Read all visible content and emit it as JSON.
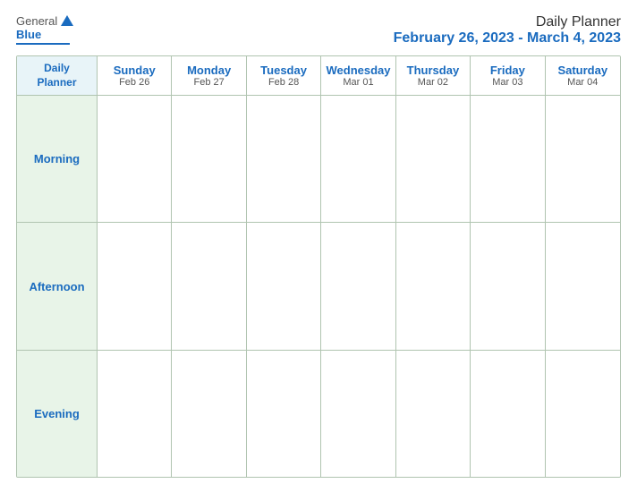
{
  "logo": {
    "general": "General",
    "blue": "Blue"
  },
  "title": {
    "main": "Daily Planner",
    "date_range": "February 26, 2023 - March 4, 2023"
  },
  "calendar": {
    "header": {
      "label": "Daily\nPlanner",
      "days": [
        {
          "name": "Sunday",
          "date": "Feb 26"
        },
        {
          "name": "Monday",
          "date": "Feb 27"
        },
        {
          "name": "Tuesday",
          "date": "Feb 28"
        },
        {
          "name": "Wednesday",
          "date": "Mar 01"
        },
        {
          "name": "Thursday",
          "date": "Mar 02"
        },
        {
          "name": "Friday",
          "date": "Mar 03"
        },
        {
          "name": "Saturday",
          "date": "Mar 04"
        }
      ]
    },
    "rows": [
      {
        "label": "Morning"
      },
      {
        "label": "Afternoon"
      },
      {
        "label": "Evening"
      }
    ]
  }
}
